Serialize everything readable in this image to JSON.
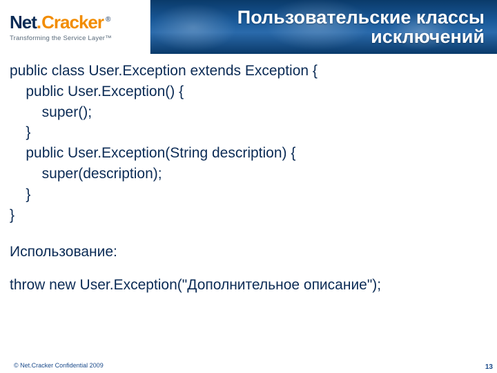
{
  "logo": {
    "net": "Net",
    "dot": ".",
    "cracker": "Cracker",
    "reg": "®",
    "tagline": "Transforming the Service Layer™"
  },
  "title": {
    "line1": "Пользовательские классы",
    "line2": "исключений"
  },
  "code": "public class User.Exception extends Exception {\n    public User.Exception() {\n        super();\n    }\n    public User.Exception(String description) {\n        super(description);\n    }\n}",
  "usage_label": "Использование:",
  "throw_line": "throw new User.Exception(\"Дополнительное описание\");",
  "footer": "© Net.Cracker Confidential 2009",
  "page": "13"
}
